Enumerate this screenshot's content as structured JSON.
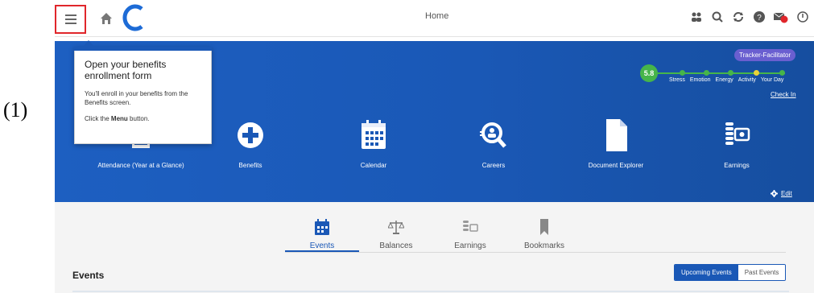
{
  "step_label": "(1)",
  "header": {
    "title": "Home"
  },
  "tracker": {
    "badge": "Tracker-Facilitator",
    "score": "5.8",
    "steps": [
      "Stress",
      "Emotion",
      "Energy",
      "Activity",
      "Your Day"
    ],
    "active_step": "Activity",
    "checkin": "Check In"
  },
  "tiles": [
    {
      "label": "Attendance (Year at a Glance)",
      "icon": "calendar-grid-icon"
    },
    {
      "label": "Benefits",
      "icon": "plus-circle-icon"
    },
    {
      "label": "Calendar",
      "icon": "calendar-icon"
    },
    {
      "label": "Careers",
      "icon": "search-person-icon"
    },
    {
      "label": "Document Explorer",
      "icon": "document-icon"
    },
    {
      "label": "Earnings",
      "icon": "coins-money-icon"
    }
  ],
  "edit_label": "Edit",
  "tooltip": {
    "title": "Open your benefits enrollment form",
    "body": "You'll enroll in your benefits from the Benefits screen.",
    "click_prefix": "Click the",
    "click_bold": "Menu",
    "click_suffix": "button."
  },
  "tabs": [
    {
      "label": "Events",
      "icon": "calendar-icon",
      "active": true
    },
    {
      "label": "Balances",
      "icon": "scale-icon",
      "active": false
    },
    {
      "label": "Earnings",
      "icon": "coins-money-icon",
      "active": false
    },
    {
      "label": "Bookmarks",
      "icon": "bookmark-icon",
      "active": false
    }
  ],
  "events": {
    "heading": "Events",
    "toggle_on": "Upcoming Events",
    "toggle_off": "Past Events"
  },
  "colors": {
    "accent": "#1a58b6",
    "highlight_border": "#e0262b",
    "tracker_green": "#46b54a",
    "tracker_badge": "#6a5fd0"
  }
}
